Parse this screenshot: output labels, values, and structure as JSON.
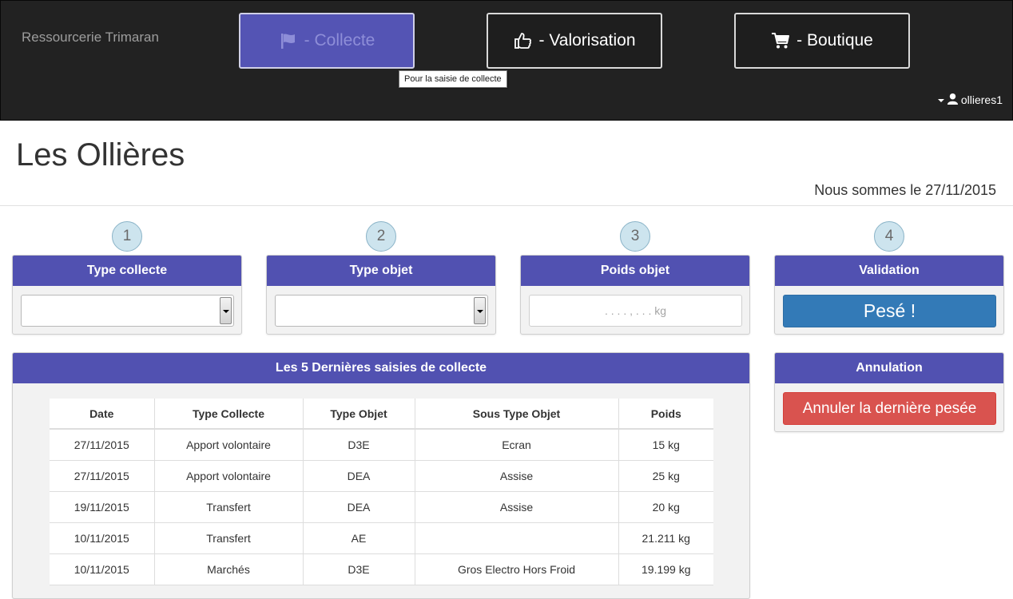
{
  "navbar": {
    "brand": "Ressourcerie Trimaran",
    "buttons": [
      {
        "label": "- Collecte",
        "icon": "flag-icon"
      },
      {
        "label": "- Valorisation",
        "icon": "thumbs-up-icon"
      },
      {
        "label": "- Boutique",
        "icon": "shopping-cart-icon"
      }
    ],
    "tooltip": "Pour la saisie de collecte",
    "user": "ollieres1"
  },
  "page": {
    "title": "Les Ollières",
    "date_line": "Nous sommes le 27/11/2015"
  },
  "steps": [
    "1",
    "2",
    "3",
    "4"
  ],
  "panels": {
    "type_collecte": {
      "title": "Type collecte",
      "value": ""
    },
    "type_objet": {
      "title": "Type objet",
      "value": ""
    },
    "poids_objet": {
      "title": "Poids objet",
      "placeholder": ". . . . , . . . kg"
    },
    "validation": {
      "title": "Validation",
      "button": "Pesé !"
    },
    "annulation": {
      "title": "Annulation",
      "button": "Annuler la dernière pesée"
    }
  },
  "recent": {
    "title": "Les 5 Dernières saisies de collecte",
    "headers": [
      "Date",
      "Type Collecte",
      "Type Objet",
      "Sous Type Objet",
      "Poids"
    ],
    "rows": [
      [
        "27/11/2015",
        "Apport volontaire",
        "D3E",
        "Ecran",
        "15 kg"
      ],
      [
        "27/11/2015",
        "Apport volontaire",
        "DEA",
        "Assise",
        "25 kg"
      ],
      [
        "19/11/2015",
        "Transfert",
        "DEA",
        "Assise",
        "20 kg"
      ],
      [
        "10/11/2015",
        "Transfert",
        "AE",
        "",
        "21.211 kg"
      ],
      [
        "10/11/2015",
        "Marchés",
        "D3E",
        "Gros Electro Hors Froid",
        "19.199 kg"
      ]
    ]
  },
  "colors": {
    "panel_header": "#5151b1",
    "active_nav": "#5454b4",
    "primary": "#337ab7",
    "danger": "#d9534f"
  }
}
